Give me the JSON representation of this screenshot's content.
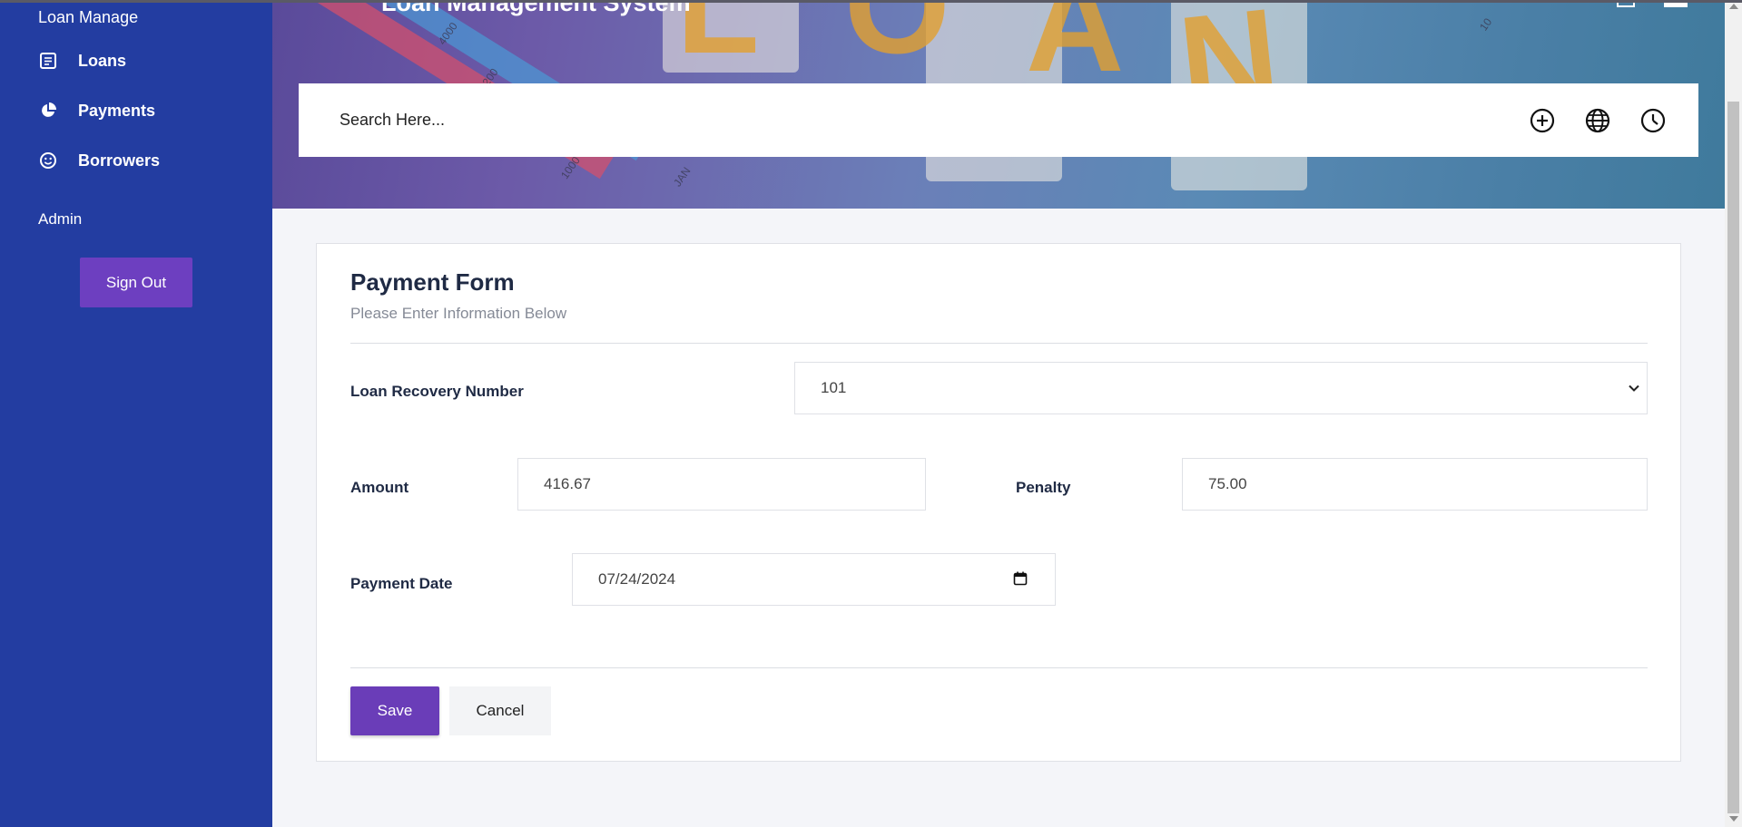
{
  "sidebar": {
    "brand": "Loan Manage",
    "items": [
      {
        "label": "Loans",
        "icon": "document-icon"
      },
      {
        "label": "Payments",
        "icon": "pie-chart-icon"
      },
      {
        "label": "Borrowers",
        "icon": "smiley-icon"
      }
    ],
    "user": "Admin",
    "sign_out": "Sign Out"
  },
  "header": {
    "title": "Loan Management System",
    "banner_letters": [
      "L",
      "O",
      "A",
      "N"
    ],
    "banner_numbers": [
      "4000",
      "200",
      "1000",
      "JAN",
      "10"
    ],
    "search_placeholder": "Search Here...",
    "icons": [
      "plus-circle-icon",
      "globe-icon",
      "clock-icon"
    ]
  },
  "form": {
    "title": "Payment Form",
    "subtitle": "Please Enter Information Below",
    "loan_recovery_label": "Loan Recovery Number",
    "loan_recovery_value": "101",
    "amount_label": "Amount",
    "amount_value": "416.67",
    "penalty_label": "Penalty",
    "penalty_value": "75.00",
    "payment_date_label": "Payment Date",
    "payment_date_value": "07/24/2024",
    "save": "Save",
    "cancel": "Cancel"
  },
  "colors": {
    "sidebar": "#233da1",
    "accent": "#6a3db8",
    "background": "#f4f5f9"
  }
}
